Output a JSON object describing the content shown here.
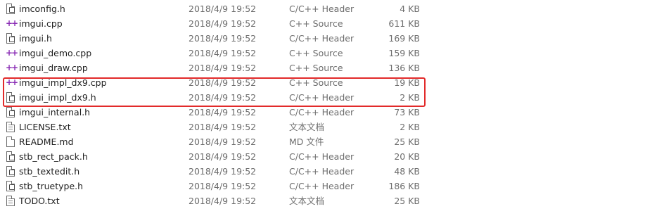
{
  "files": [
    {
      "name": "imconfig.h",
      "date": "2018/4/9 19:52",
      "type": "C/C++ Header",
      "size": "4 KB",
      "icon": "header-file-icon"
    },
    {
      "name": "imgui.cpp",
      "date": "2018/4/9 19:52",
      "type": "C++ Source",
      "size": "611 KB",
      "icon": "cpp-file-icon"
    },
    {
      "name": "imgui.h",
      "date": "2018/4/9 19:52",
      "type": "C/C++ Header",
      "size": "169 KB",
      "icon": "header-file-icon"
    },
    {
      "name": "imgui_demo.cpp",
      "date": "2018/4/9 19:52",
      "type": "C++ Source",
      "size": "159 KB",
      "icon": "cpp-file-icon"
    },
    {
      "name": "imgui_draw.cpp",
      "date": "2018/4/9 19:52",
      "type": "C++ Source",
      "size": "136 KB",
      "icon": "cpp-file-icon"
    },
    {
      "name": "imgui_impl_dx9.cpp",
      "date": "2018/4/9 19:52",
      "type": "C++ Source",
      "size": "19 KB",
      "icon": "cpp-file-icon"
    },
    {
      "name": "imgui_impl_dx9.h",
      "date": "2018/4/9 19:52",
      "type": "C/C++ Header",
      "size": "2 KB",
      "icon": "header-file-icon"
    },
    {
      "name": "imgui_internal.h",
      "date": "2018/4/9 19:52",
      "type": "C/C++ Header",
      "size": "73 KB",
      "icon": "header-file-icon"
    },
    {
      "name": "LICENSE.txt",
      "date": "2018/4/9 19:52",
      "type": "文本文档",
      "size": "2 KB",
      "icon": "text-file-icon"
    },
    {
      "name": "README.md",
      "date": "2018/4/9 19:52",
      "type": "MD 文件",
      "size": "25 KB",
      "icon": "generic-file-icon"
    },
    {
      "name": "stb_rect_pack.h",
      "date": "2018/4/9 19:52",
      "type": "C/C++ Header",
      "size": "20 KB",
      "icon": "header-file-icon"
    },
    {
      "name": "stb_textedit.h",
      "date": "2018/4/9 19:52",
      "type": "C/C++ Header",
      "size": "48 KB",
      "icon": "header-file-icon"
    },
    {
      "name": "stb_truetype.h",
      "date": "2018/4/9 19:52",
      "type": "C/C++ Header",
      "size": "186 KB",
      "icon": "header-file-icon"
    },
    {
      "name": "TODO.txt",
      "date": "2018/4/9 19:52",
      "type": "文本文档",
      "size": "25 KB",
      "icon": "text-file-icon"
    }
  ],
  "highlight": {
    "color": "#e22a2a",
    "rows": [
      "imgui_impl_dx9.cpp",
      "imgui_impl_dx9.h"
    ]
  }
}
